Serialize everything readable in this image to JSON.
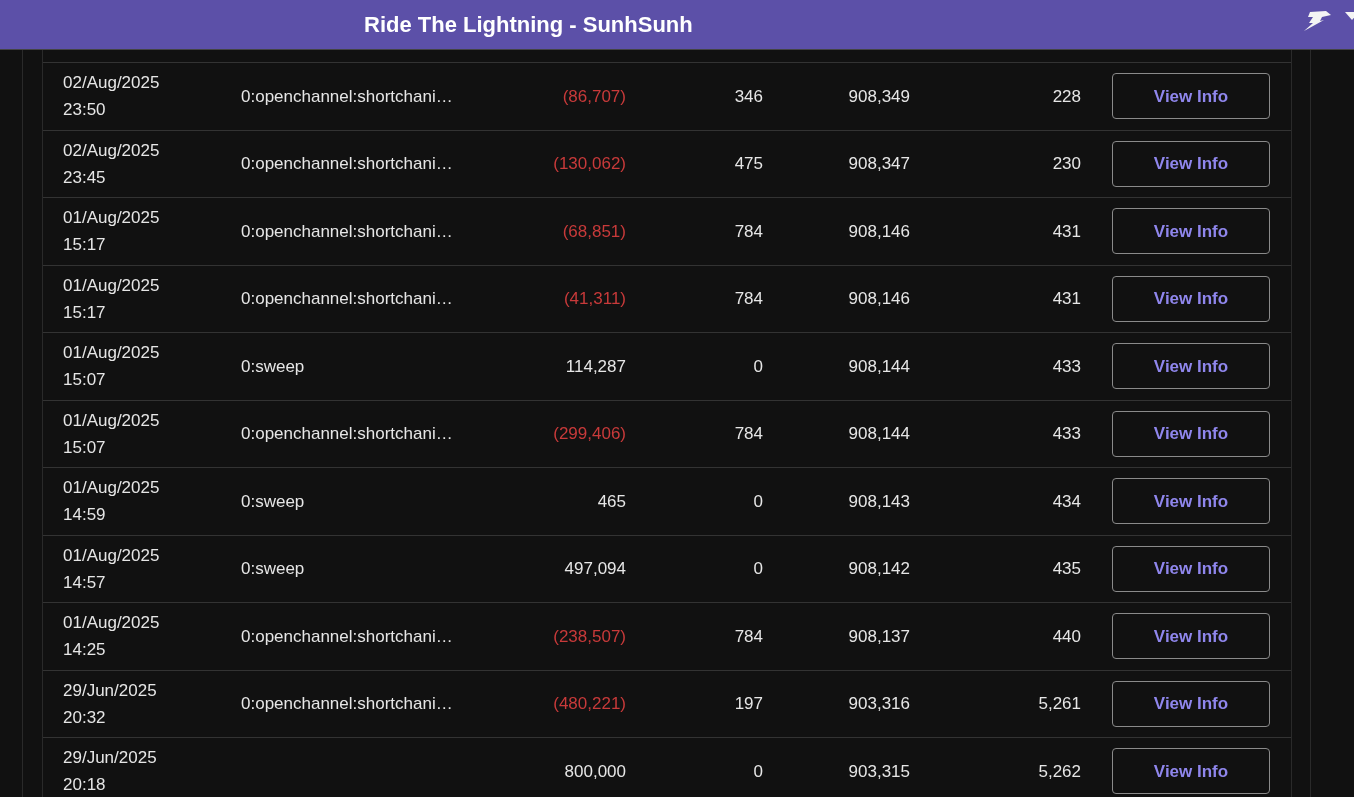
{
  "header": {
    "title": "Ride The Lightning - SunhSunh"
  },
  "rows": [
    {
      "date": "02/Aug/2025",
      "time": "23:50",
      "label": "0:openchannel:shortchani…",
      "amount": "(86,707)",
      "negative": true,
      "column_4": "346",
      "column_5": "908,349",
      "column_6": "228",
      "button": "View Info"
    },
    {
      "date": "02/Aug/2025",
      "time": "23:45",
      "label": "0:openchannel:shortchani…",
      "amount": "(130,062)",
      "negative": true,
      "column_4": "475",
      "column_5": "908,347",
      "column_6": "230",
      "button": "View Info"
    },
    {
      "date": "01/Aug/2025",
      "time": "15:17",
      "label": "0:openchannel:shortchani…",
      "amount": "(68,851)",
      "negative": true,
      "column_4": "784",
      "column_5": "908,146",
      "column_6": "431",
      "button": "View Info"
    },
    {
      "date": "01/Aug/2025",
      "time": "15:17",
      "label": "0:openchannel:shortchani…",
      "amount": "(41,311)",
      "negative": true,
      "column_4": "784",
      "column_5": "908,146",
      "column_6": "431",
      "button": "View Info"
    },
    {
      "date": "01/Aug/2025",
      "time": "15:07",
      "label": "0:sweep",
      "amount": "114,287",
      "negative": false,
      "column_4": "0",
      "column_5": "908,144",
      "column_6": "433",
      "button": "View Info"
    },
    {
      "date": "01/Aug/2025",
      "time": "15:07",
      "label": "0:openchannel:shortchani…",
      "amount": "(299,406)",
      "negative": true,
      "column_4": "784",
      "column_5": "908,144",
      "column_6": "433",
      "button": "View Info"
    },
    {
      "date": "01/Aug/2025",
      "time": "14:59",
      "label": "0:sweep",
      "amount": "465",
      "negative": false,
      "column_4": "0",
      "column_5": "908,143",
      "column_6": "434",
      "button": "View Info"
    },
    {
      "date": "01/Aug/2025",
      "time": "14:57",
      "label": "0:sweep",
      "amount": "497,094",
      "negative": false,
      "column_4": "0",
      "column_5": "908,142",
      "column_6": "435",
      "button": "View Info"
    },
    {
      "date": "01/Aug/2025",
      "time": "14:25",
      "label": "0:openchannel:shortchani…",
      "amount": "(238,507)",
      "negative": true,
      "column_4": "784",
      "column_5": "908,137",
      "column_6": "440",
      "button": "View Info"
    },
    {
      "date": "29/Jun/2025",
      "time": "20:32",
      "label": "0:openchannel:shortchani…",
      "amount": "(480,221)",
      "negative": true,
      "column_4": "197",
      "column_5": "903,316",
      "column_6": "5,261",
      "button": "View Info"
    },
    {
      "date": "29/Jun/2025",
      "time": "20:18",
      "amount": "800,000",
      "negative": false,
      "column_4": "0",
      "column_5": "903,315",
      "column_6": "5,262",
      "button": "View Info"
    }
  ]
}
